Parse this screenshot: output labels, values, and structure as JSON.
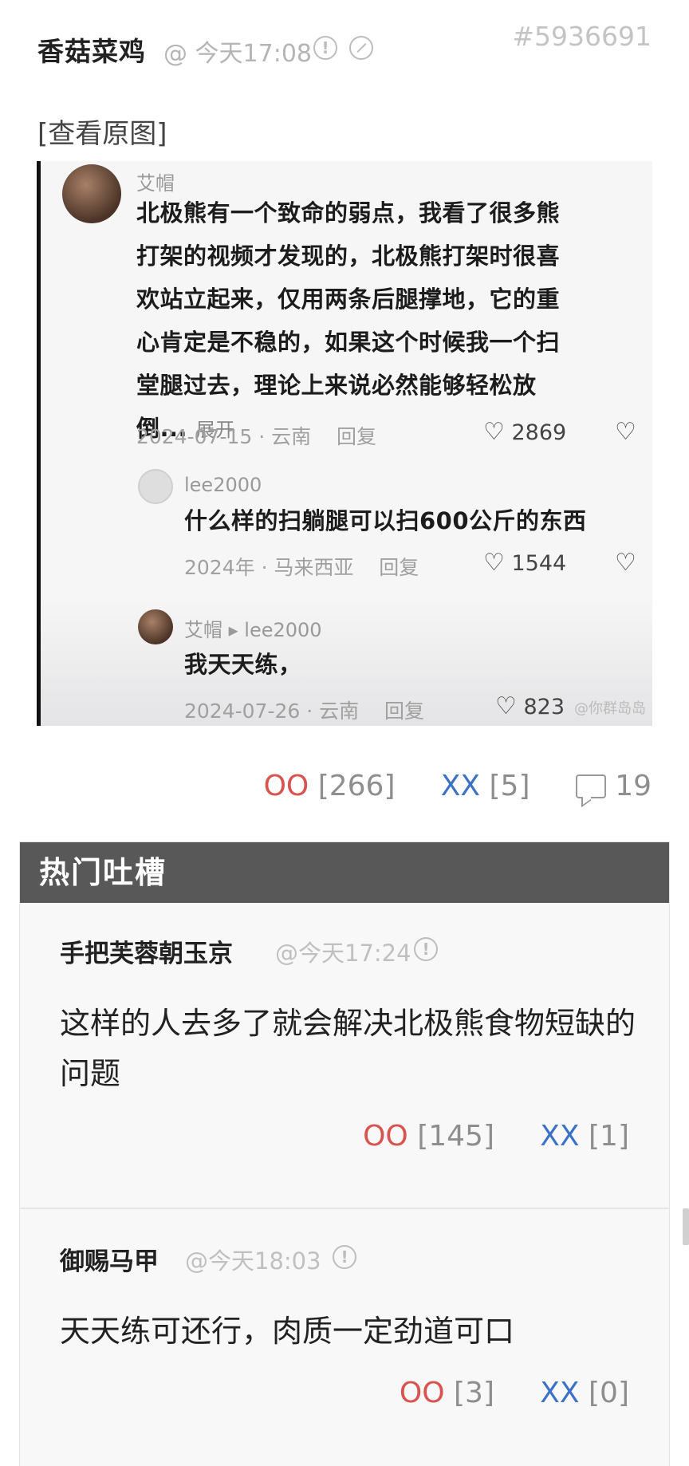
{
  "post": {
    "author": "香菇菜鸡",
    "time": "@ 今天17:08",
    "report_icon": "exclamation-circle-icon",
    "block_icon": "slash-circle-icon",
    "id": "#5936691",
    "view_original": "[查看原图]",
    "actions": {
      "oo_label": "OO",
      "oo_count": "[266]",
      "xx_label": "XX",
      "xx_count": "[5]",
      "comments_icon": "comment-bubble-icon",
      "comments": "19"
    }
  },
  "quoted_image": {
    "comment1": {
      "name": "艾帽",
      "text": "北极熊有一个致命的弱点，我看了很多熊打架的视频才发现的，北极熊打架时很喜欢站立起来，仅用两条后腿撑地，它的重心肯定是不稳的，如果这个时候我一个扫堂腿过去，理论上来说必然能够轻松放倒...",
      "expand": "展开",
      "date": "2024-07-15",
      "location": "云南",
      "reply": "回复",
      "likes": "2869"
    },
    "reply1": {
      "name": "lee2000",
      "text": "什么样的扫躺腿可以扫600公斤的东西",
      "date": "2024年",
      "location": "马来西亚",
      "reply": "回复",
      "likes": "1544"
    },
    "reply2": {
      "name": "艾帽 ▸ lee2000",
      "text": "我天天练，",
      "date": "2024-07-26",
      "location": "云南",
      "reply": "回复",
      "likes": "823"
    },
    "watermark": "@你群岛岛"
  },
  "hot": {
    "title": "热门吐槽",
    "comments": [
      {
        "name": "手把芙蓉朝玉京",
        "time": "@今天17:24",
        "text": "这样的人去多了就会解决北极熊食物短缺的问题",
        "oo_label": "OO",
        "oo_count": "[145]",
        "xx_label": "XX",
        "xx_count": "[1]"
      },
      {
        "name": "御赐马甲",
        "time": "@今天18:03",
        "text": "天天练可还行，肉质一定劲道可口",
        "oo_label": "OO",
        "oo_count": "[3]",
        "xx_label": "XX",
        "xx_count": "[0]"
      }
    ]
  },
  "colors": {
    "oo": "#d9534f",
    "xx": "#3c71c8",
    "hot_header": "#585858"
  }
}
